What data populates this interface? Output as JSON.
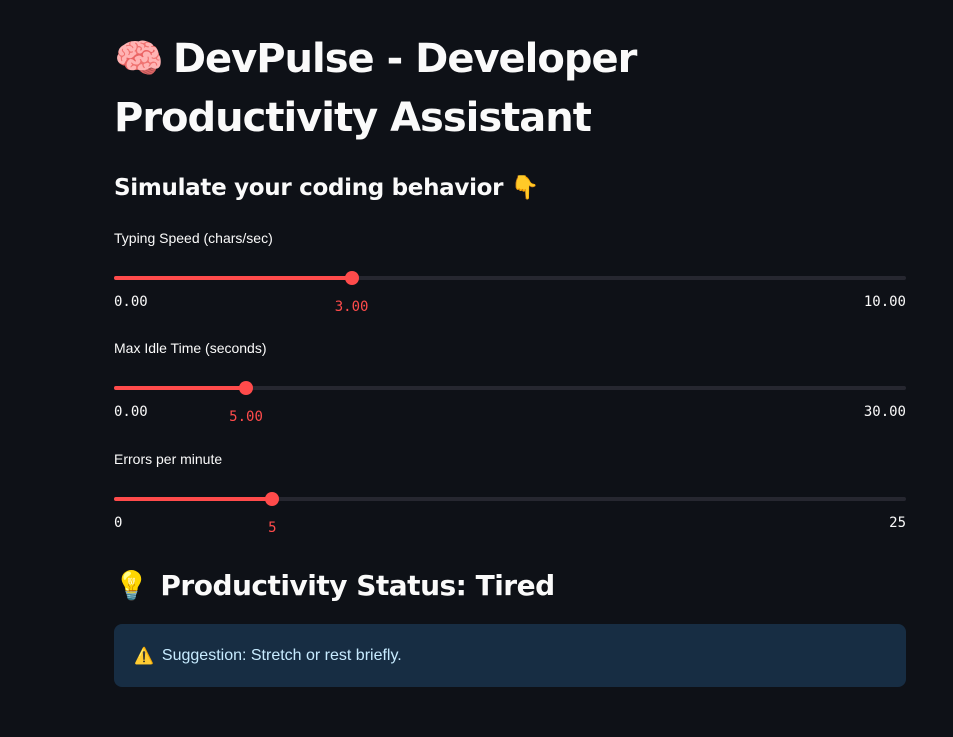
{
  "header": {
    "title_emoji": "🧠",
    "title": "DevPulse - Developer Productivity Assistant",
    "subheader": "Simulate your coding behavior 👇"
  },
  "sliders": [
    {
      "label": "Typing Speed (chars/sec)",
      "value": "3.00",
      "min": "0.00",
      "max": "10.00",
      "fraction": 0.3
    },
    {
      "label": "Max Idle Time (seconds)",
      "value": "5.00",
      "min": "0.00",
      "max": "30.00",
      "fraction": 0.1667
    },
    {
      "label": "Errors per minute",
      "value": "5",
      "min": "0",
      "max": "25",
      "fraction": 0.2
    }
  ],
  "status": {
    "emoji": "💡",
    "text": "Productivity Status: Tired"
  },
  "alert": {
    "icon": "⚠️",
    "text": "Suggestion: Stretch or rest briefly."
  },
  "colors": {
    "background": "#0e1117",
    "accent": "#ff4b4b",
    "track": "#262730",
    "alert_bg": "#172d43",
    "alert_text": "#c7ebff"
  }
}
